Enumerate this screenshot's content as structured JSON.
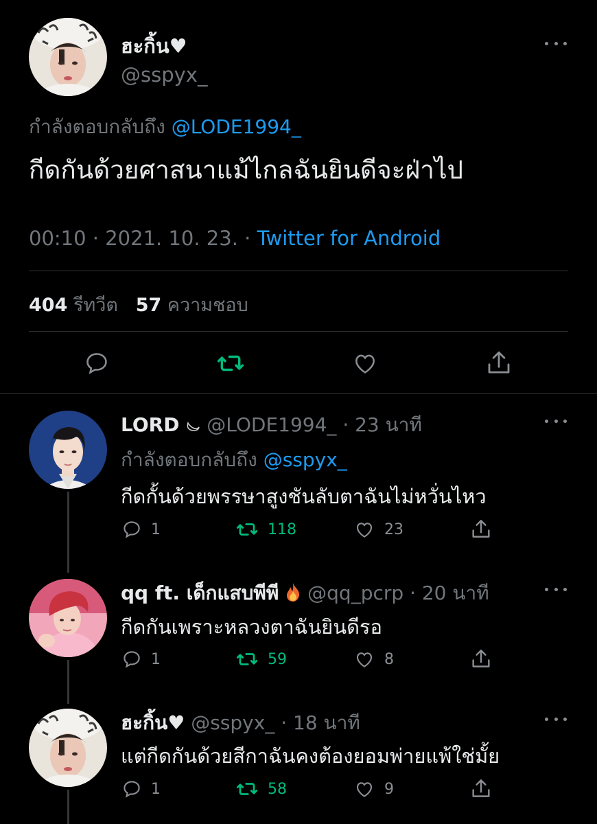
{
  "main_tweet": {
    "display_name": "ฮะกิ้น♥",
    "handle": "@sspyx_",
    "replying_prefix": "กำลังตอบกลับถึง",
    "replying_to": "@LODE1994_",
    "text": "กีดกันด้วยศาสนาแม้ไกลฉันยินดีจะฝ่าไป",
    "time": "00:10 · 2021. 10. 23. · ",
    "source": "Twitter for Android",
    "retweet_count": "404",
    "retweet_label": "รีทวีต",
    "like_count": "57",
    "like_label": "ความชอบ"
  },
  "replies": [
    {
      "display_name": "LORD",
      "meta": "@LODE1994_ · 23 นาที",
      "replying_prefix": "กำลังตอบกลับถึง",
      "replying_to": "@sspyx_",
      "text": "กีดกั้นด้วยพรรษาสูงชันลับตาฉันไม่หวั่นไหว",
      "reply_count": "1",
      "retweet_count": "118",
      "like_count": "23"
    },
    {
      "display_name": "qq ft. เด็กแสบพีพี",
      "meta": "@qq_pcrp · 20 นาที",
      "text": "กีดกันเพราะหลวงตาฉันยินดีรอ",
      "reply_count": "1",
      "retweet_count": "59",
      "like_count": "8"
    },
    {
      "display_name": "ฮะกิ้น♥",
      "meta": "@sspyx_ · 18 นาที",
      "text": "แต่กีดกันด้วยสีกาฉันคงต้องยอมพ่ายแพ้ใช่มั้ย",
      "reply_count": "1",
      "retweet_count": "58",
      "like_count": "9"
    }
  ],
  "colors": {
    "background": "#000000",
    "link": "#1d9bf0",
    "retweet_active": "#00ba7c",
    "muted": "#71767b",
    "text": "#e7e9ea"
  }
}
